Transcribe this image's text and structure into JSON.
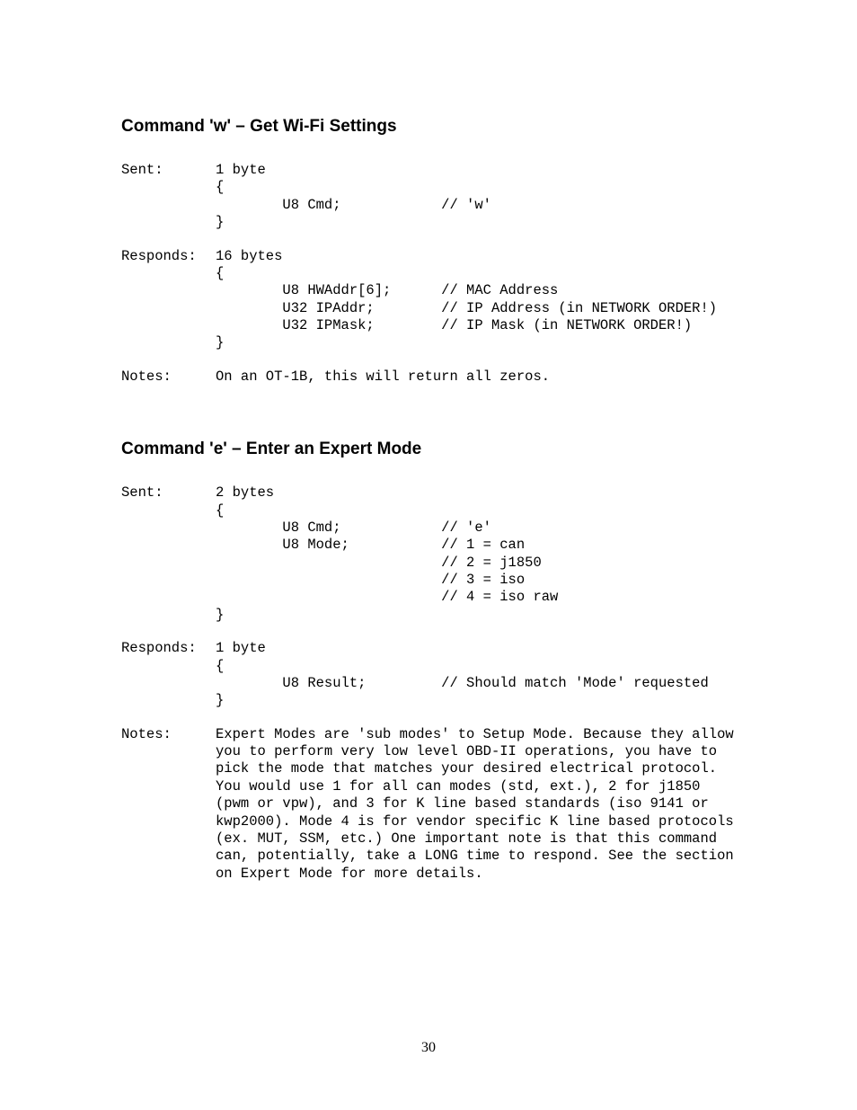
{
  "page_number": "30",
  "section1": {
    "heading": "Command 'w' – Get Wi-Fi Settings",
    "sent_label": "Sent:",
    "sent_body": "1 byte\n{\n        U8 Cmd;            // 'w'\n}",
    "responds_label": "Responds:",
    "responds_body": "16 bytes\n{\n        U8 HWAddr[6];      // MAC Address\n        U32 IPAddr;        // IP Address (in NETWORK ORDER!)\n        U32 IPMask;        // IP Mask (in NETWORK ORDER!)\n}",
    "notes_label": "Notes:",
    "notes_body": "On an OT-1B, this will return all zeros."
  },
  "section2": {
    "heading": "Command 'e' – Enter an Expert Mode",
    "sent_label": "Sent:",
    "sent_body": "2 bytes\n{\n        U8 Cmd;            // 'e'\n        U8 Mode;           // 1 = can\n                           // 2 = j1850\n                           // 3 = iso\n                           // 4 = iso raw\n}",
    "responds_label": "Responds:",
    "responds_body": "1 byte\n{\n        U8 Result;         // Should match 'Mode' requested\n}",
    "notes_label": "Notes:",
    "notes_body": "Expert Modes are 'sub modes' to Setup Mode. Because they allow you to perform very low level OBD-II operations, you have to pick the mode that matches your desired electrical protocol. You would use 1 for all can modes (std, ext.), 2 for j1850 (pwm or vpw), and 3 for K line based standards (iso 9141 or kwp2000). Mode 4 is for vendor specific K line based protocols (ex. MUT, SSM, etc.) One important note is that this command can, potentially, take a LONG time to respond. See the section on Expert Mode for more details."
  }
}
